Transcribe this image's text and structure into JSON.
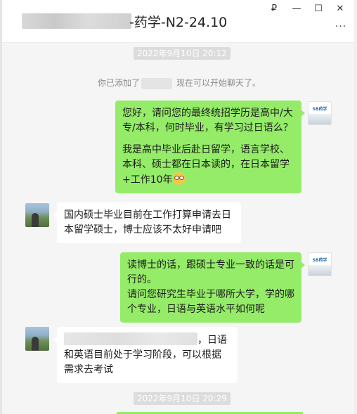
{
  "window": {
    "title": "-药学-N2-24.10",
    "controls": {
      "pin": "₽",
      "minimize": "—",
      "maximize": "☐",
      "close": "✕"
    },
    "more": "···"
  },
  "chat": {
    "timestamps": [
      "2022年9月10日 20:12",
      "2022年9月10日 20:29"
    ],
    "system_message": {
      "prefix": "你已添加了",
      "suffix": "现在可以开始聊天了。"
    },
    "messages": [
      {
        "sender": "me",
        "paragraphs": [
          "您好，请问您的最终统招学历是高中/大专/本科，何时毕业，有学习过日语么？",
          "我是高中毕业后赴日留学，语言学校、本科、硕士都在日本读的，在日本留学+工作10年"
        ]
      },
      {
        "sender": "other",
        "text": "国内硕士毕业目前在工作打算申请去日本留学硕士，博士应该不太好申请吧"
      },
      {
        "sender": "me",
        "text": "读博士的话，跟硕士专业一致的话是可行的。\n请问您研究生毕业于哪所大学，学的哪个专业，日语与英语水平如何呢"
      },
      {
        "sender": "other",
        "text_tail": "，日语",
        "text_rest": "和英语目前处于学习阶段，可以根据需求去考试"
      }
    ]
  },
  "avatar_me_label": "SB药学",
  "colors": {
    "bubble_me": "#95ec69",
    "bubble_other": "#ffffff",
    "chat_bg": "#f5f5f5"
  }
}
